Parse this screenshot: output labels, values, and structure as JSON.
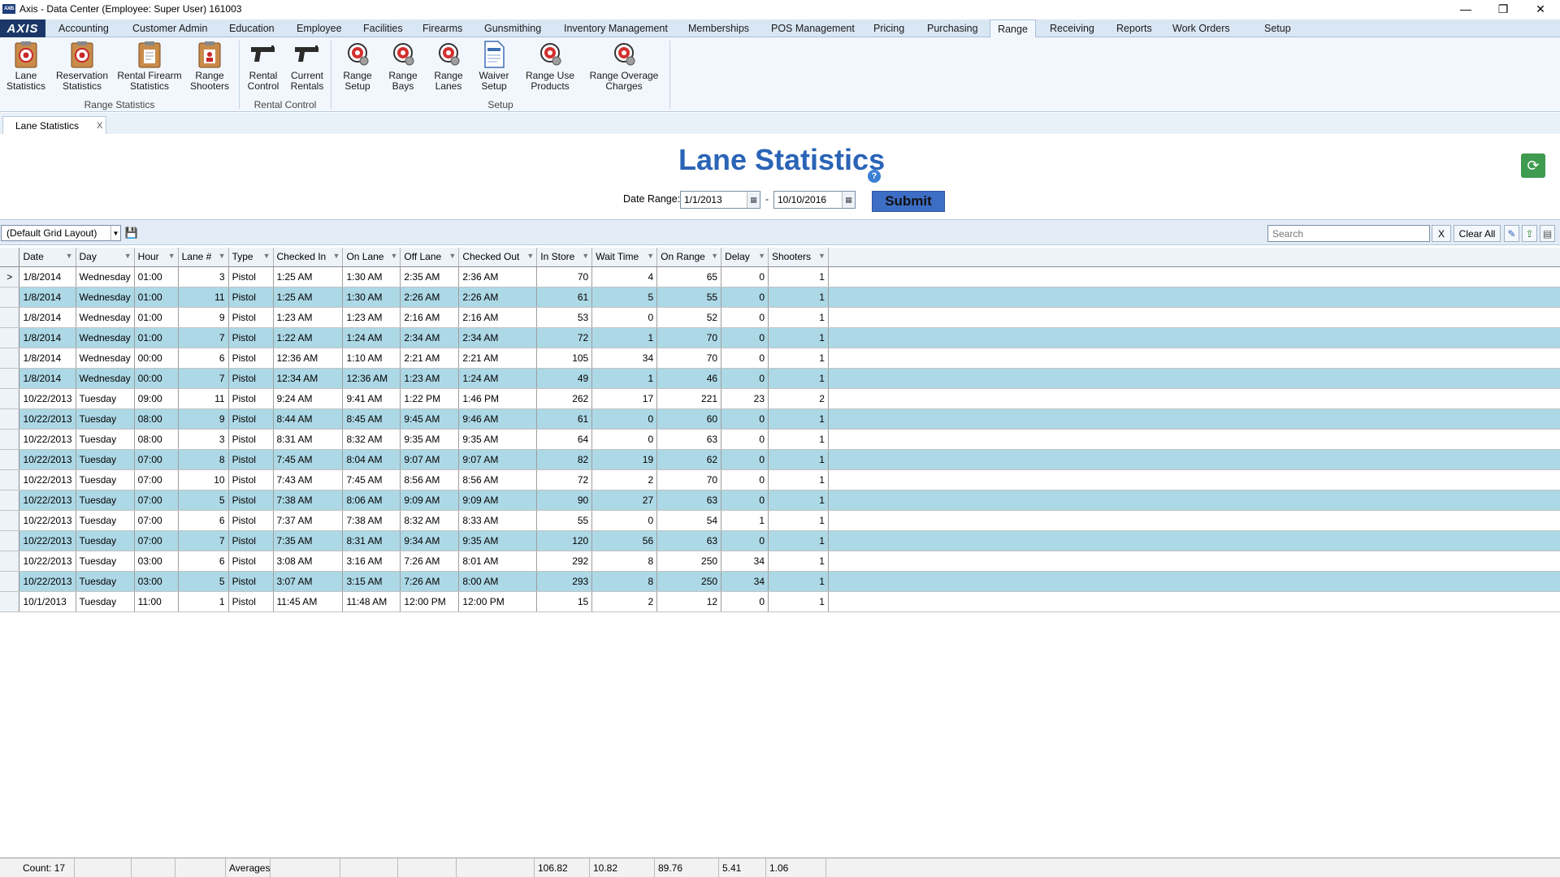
{
  "window": {
    "title": "Axis - Data Center  (Employee: Super User) 161003",
    "minimize_glyph": "—",
    "maximize_glyph": "❐",
    "close_glyph": "✕",
    "app_icon_text": "AXIS"
  },
  "menu": {
    "logo": "AXIS",
    "tabs": [
      "Accounting",
      "Customer Admin",
      "Education",
      "Employee",
      "Facilities",
      "Firearms",
      "Gunsmithing",
      "Inventory Management",
      "Memberships",
      "POS Management",
      "Pricing",
      "Purchasing",
      "Range",
      "Receiving",
      "Reports",
      "Work Orders",
      "Setup"
    ],
    "active": "Range"
  },
  "ribbon": {
    "buttons": [
      {
        "line1": "Lane",
        "line2": "Statistics",
        "icon": "clipboard-target-icon"
      },
      {
        "line1": "Reservation",
        "line2": "Statistics",
        "icon": "clipboard-target-icon"
      },
      {
        "line1": "Rental Firearm",
        "line2": "Statistics",
        "icon": "clipboard-document-icon"
      },
      {
        "line1": "Range",
        "line2": "Shooters",
        "icon": "clipboard-person-icon"
      },
      {
        "line1": "Rental",
        "line2": "Control",
        "icon": "pistol-icon"
      },
      {
        "line1": "Current",
        "line2": "Rentals",
        "icon": "pistol-icon"
      },
      {
        "line1": "Range",
        "line2": "Setup",
        "icon": "target-gear-icon"
      },
      {
        "line1": "Range",
        "line2": "Bays",
        "icon": "target-gear-icon"
      },
      {
        "line1": "Range",
        "line2": "Lanes",
        "icon": "target-gear-icon"
      },
      {
        "line1": "Waiver",
        "line2": "Setup",
        "icon": "waiver-document-icon"
      },
      {
        "line1": "Range Use",
        "line2": "Products",
        "icon": "target-gear-icon"
      },
      {
        "line1": "Range Overage",
        "line2": "Charges",
        "icon": "target-gear-icon"
      }
    ],
    "groups": [
      "Range Statistics",
      "Rental Control",
      "Setup"
    ],
    "colors": {
      "target_red": "#d32f2f",
      "clipboard_brown": "#b5651d"
    }
  },
  "doc_tab": {
    "label": "Lane Statistics",
    "close": "X"
  },
  "header": {
    "title": "Lane Statistics",
    "help": "?",
    "refresh_icon": "refresh-icon",
    "date_range_label": "Date Range:",
    "date_from": "1/1/2013",
    "date_to": "10/10/2016",
    "dash": "-",
    "submit": "Submit"
  },
  "toolbar": {
    "layout": "(Default Grid Layout)",
    "search_placeholder": "Search",
    "clear_x": "X",
    "clear_all": "Clear All"
  },
  "grid": {
    "columns": [
      "Date",
      "Day",
      "Hour",
      "Lane #",
      "Type",
      "Checked In",
      "On Lane",
      "Off Lane",
      "Checked Out",
      "In Store",
      "Wait Time",
      "On Range",
      "Delay",
      "Shooters"
    ],
    "rows": [
      [
        "1/8/2014",
        "Wednesday",
        "01:00",
        "3",
        "Pistol",
        "1:25 AM",
        "1:30 AM",
        "2:35 AM",
        "2:36 AM",
        "70",
        "4",
        "65",
        "0",
        "1"
      ],
      [
        "1/8/2014",
        "Wednesday",
        "01:00",
        "11",
        "Pistol",
        "1:25 AM",
        "1:30 AM",
        "2:26 AM",
        "2:26 AM",
        "61",
        "5",
        "55",
        "0",
        "1"
      ],
      [
        "1/8/2014",
        "Wednesday",
        "01:00",
        "9",
        "Pistol",
        "1:23 AM",
        "1:23 AM",
        "2:16 AM",
        "2:16 AM",
        "53",
        "0",
        "52",
        "0",
        "1"
      ],
      [
        "1/8/2014",
        "Wednesday",
        "01:00",
        "7",
        "Pistol",
        "1:22 AM",
        "1:24 AM",
        "2:34 AM",
        "2:34 AM",
        "72",
        "1",
        "70",
        "0",
        "1"
      ],
      [
        "1/8/2014",
        "Wednesday",
        "00:00",
        "6",
        "Pistol",
        "12:36 AM",
        "1:10 AM",
        "2:21 AM",
        "2:21 AM",
        "105",
        "34",
        "70",
        "0",
        "1"
      ],
      [
        "1/8/2014",
        "Wednesday",
        "00:00",
        "7",
        "Pistol",
        "12:34 AM",
        "12:36 AM",
        "1:23 AM",
        "1:24 AM",
        "49",
        "1",
        "46",
        "0",
        "1"
      ],
      [
        "10/22/2013",
        "Tuesday",
        "09:00",
        "11",
        "Pistol",
        "9:24 AM",
        "9:41 AM",
        "1:22 PM",
        "1:46 PM",
        "262",
        "17",
        "221",
        "23",
        "2"
      ],
      [
        "10/22/2013",
        "Tuesday",
        "08:00",
        "9",
        "Pistol",
        "8:44 AM",
        "8:45 AM",
        "9:45 AM",
        "9:46 AM",
        "61",
        "0",
        "60",
        "0",
        "1"
      ],
      [
        "10/22/2013",
        "Tuesday",
        "08:00",
        "3",
        "Pistol",
        "8:31 AM",
        "8:32 AM",
        "9:35 AM",
        "9:35 AM",
        "64",
        "0",
        "63",
        "0",
        "1"
      ],
      [
        "10/22/2013",
        "Tuesday",
        "07:00",
        "8",
        "Pistol",
        "7:45 AM",
        "8:04 AM",
        "9:07 AM",
        "9:07 AM",
        "82",
        "19",
        "62",
        "0",
        "1"
      ],
      [
        "10/22/2013",
        "Tuesday",
        "07:00",
        "10",
        "Pistol",
        "7:43 AM",
        "7:45 AM",
        "8:56 AM",
        "8:56 AM",
        "72",
        "2",
        "70",
        "0",
        "1"
      ],
      [
        "10/22/2013",
        "Tuesday",
        "07:00",
        "5",
        "Pistol",
        "7:38 AM",
        "8:06 AM",
        "9:09 AM",
        "9:09 AM",
        "90",
        "27",
        "63",
        "0",
        "1"
      ],
      [
        "10/22/2013",
        "Tuesday",
        "07:00",
        "6",
        "Pistol",
        "7:37 AM",
        "7:38 AM",
        "8:32 AM",
        "8:33 AM",
        "55",
        "0",
        "54",
        "1",
        "1"
      ],
      [
        "10/22/2013",
        "Tuesday",
        "07:00",
        "7",
        "Pistol",
        "7:35 AM",
        "8:31 AM",
        "9:34 AM",
        "9:35 AM",
        "120",
        "56",
        "63",
        "0",
        "1"
      ],
      [
        "10/22/2013",
        "Tuesday",
        "03:00",
        "6",
        "Pistol",
        "3:08 AM",
        "3:16 AM",
        "7:26 AM",
        "8:01 AM",
        "292",
        "8",
        "250",
        "34",
        "1"
      ],
      [
        "10/22/2013",
        "Tuesday",
        "03:00",
        "5",
        "Pistol",
        "3:07 AM",
        "3:15 AM",
        "7:26 AM",
        "8:00 AM",
        "293",
        "8",
        "250",
        "34",
        "1"
      ],
      [
        "10/1/2013",
        "Tuesday",
        "11:00",
        "1",
        "Pistol",
        "11:45 AM",
        "11:48 AM",
        "12:00 PM",
        "12:00 PM",
        "15",
        "2",
        "12",
        "0",
        "1"
      ]
    ],
    "selected_marker": ">",
    "alt_row_color": "#add8e6"
  },
  "footer": {
    "count": "Count: 17",
    "averages_label": "Averages",
    "in_store": "106.82",
    "wait_time": "10.82",
    "on_range": "89.76",
    "delay": "5.41",
    "shooters": "1.06"
  }
}
